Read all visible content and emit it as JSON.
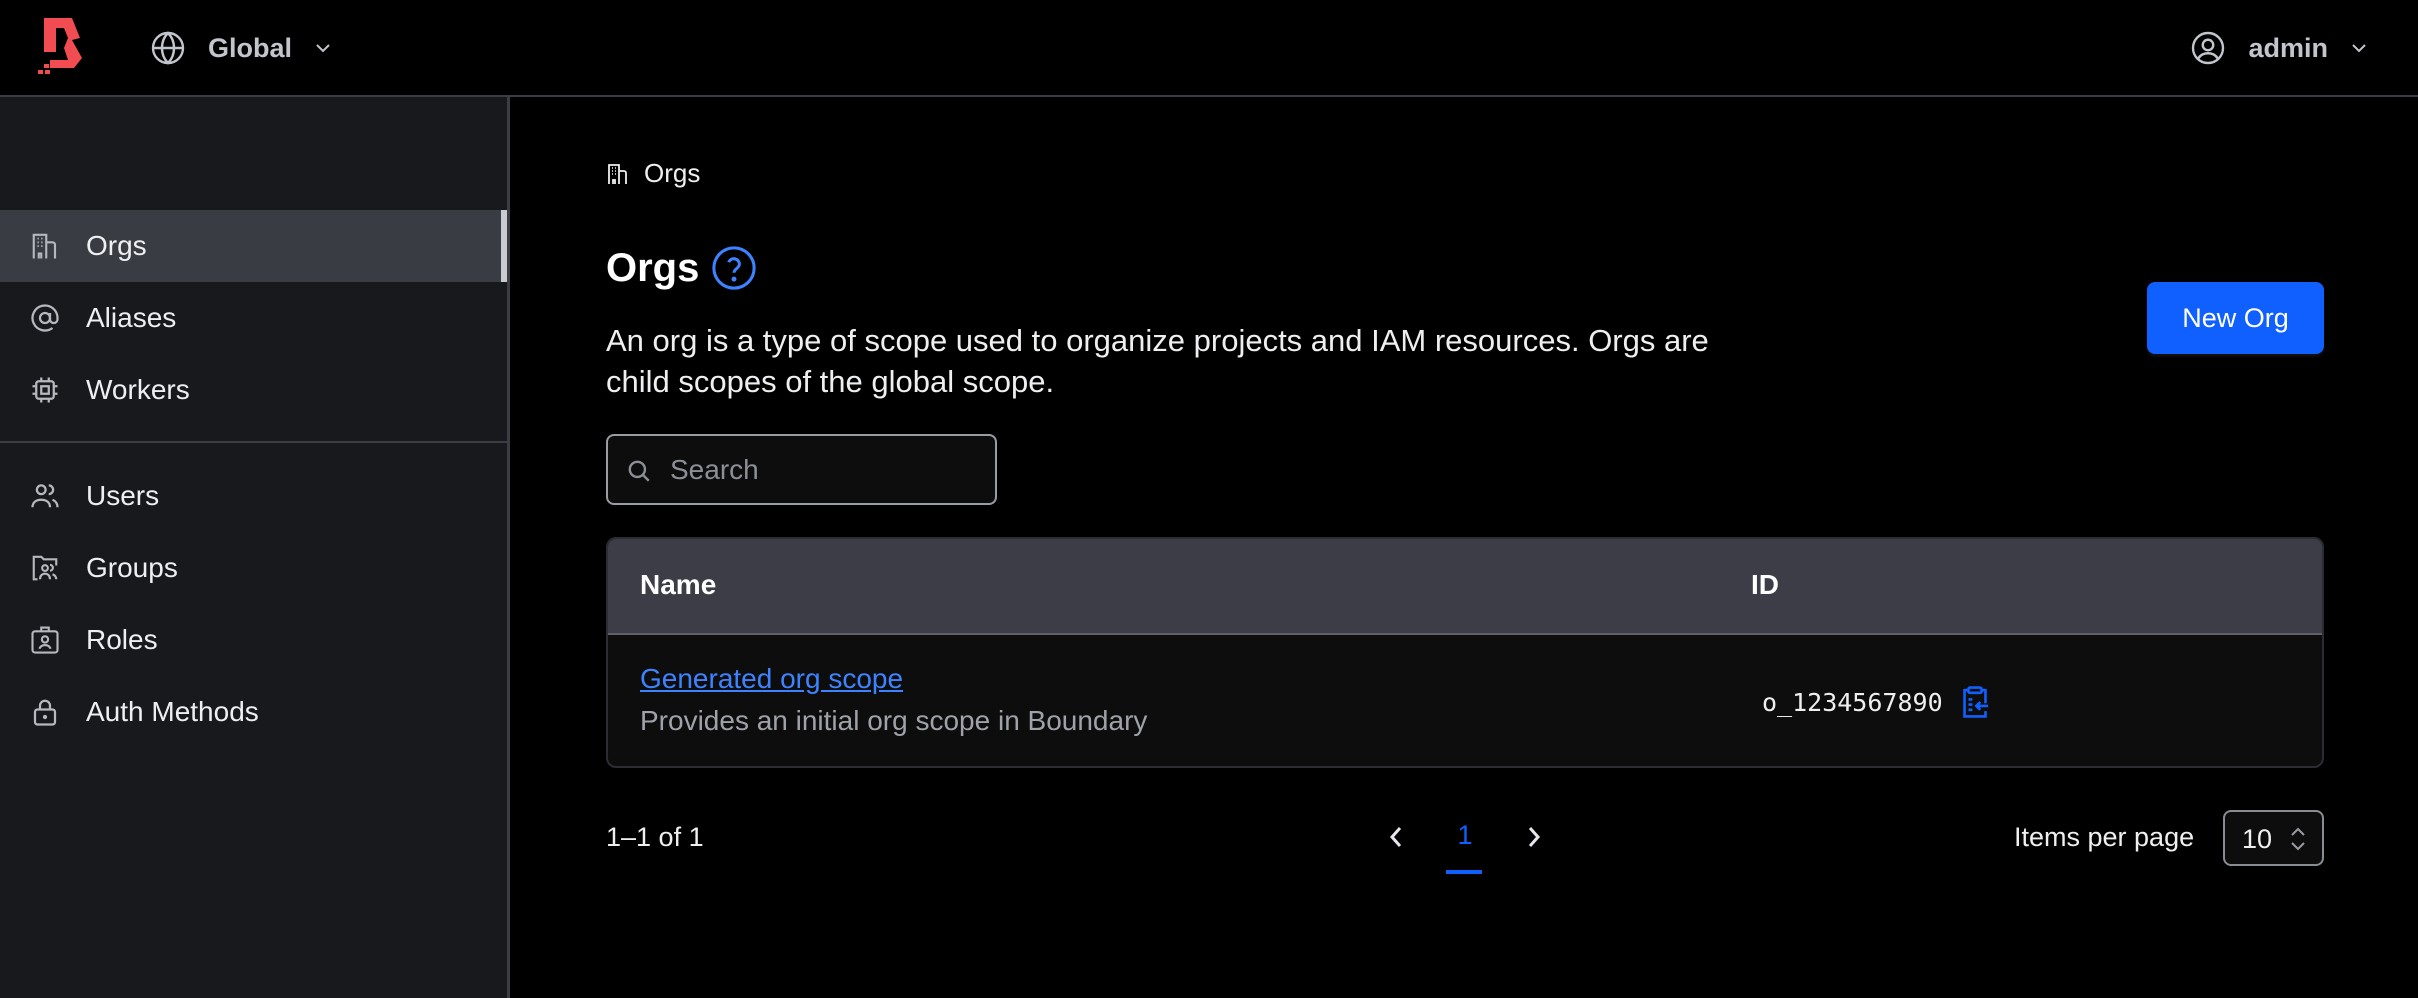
{
  "header": {
    "logo": "boundary-logo",
    "scope": {
      "icon": "globe-icon",
      "label": "Global",
      "chevron": "chevron-down-icon"
    },
    "user": {
      "icon": "user-circle-icon",
      "label": "admin",
      "chevron": "chevron-down-icon"
    }
  },
  "sidebar": {
    "groups": [
      [
        {
          "label": "Orgs",
          "icon": "building-icon",
          "active": true
        },
        {
          "label": "Aliases",
          "icon": "at-sign-icon",
          "active": false
        },
        {
          "label": "Workers",
          "icon": "cpu-icon",
          "active": false
        }
      ],
      [
        {
          "label": "Users",
          "icon": "users-icon",
          "active": false
        },
        {
          "label": "Groups",
          "icon": "folder-users-icon",
          "active": false
        },
        {
          "label": "Roles",
          "icon": "id-badge-icon",
          "active": false
        },
        {
          "label": "Auth Methods",
          "icon": "lock-icon",
          "active": false
        }
      ]
    ]
  },
  "main": {
    "breadcrumb": {
      "icon": "building-icon",
      "label": "Orgs"
    },
    "title": "Orgs",
    "help_icon": "help-circle-icon",
    "description": "An org is a type of scope used to organize projects and IAM resources. Orgs are child scopes of the global scope.",
    "new_button": "New Org",
    "search": {
      "placeholder": "Search",
      "value": ""
    },
    "table": {
      "columns": [
        "Name",
        "ID"
      ],
      "rows": [
        {
          "name": "Generated org scope",
          "description": "Provides an initial org scope in Boundary",
          "id": "o_1234567890",
          "copy_icon": "clipboard-copy-icon"
        }
      ]
    },
    "pagination": {
      "summary": "1–1 of 1",
      "current_page": "1",
      "items_per_page_label": "Items per page",
      "items_per_page": "10"
    }
  },
  "colors": {
    "accent": "#1060ff",
    "link": "#3d83ff",
    "logo": "#f24c53",
    "sidebar_bg": "#18191d",
    "active_item_bg": "#3a3c44",
    "table_header_bg": "#3c3d47"
  }
}
